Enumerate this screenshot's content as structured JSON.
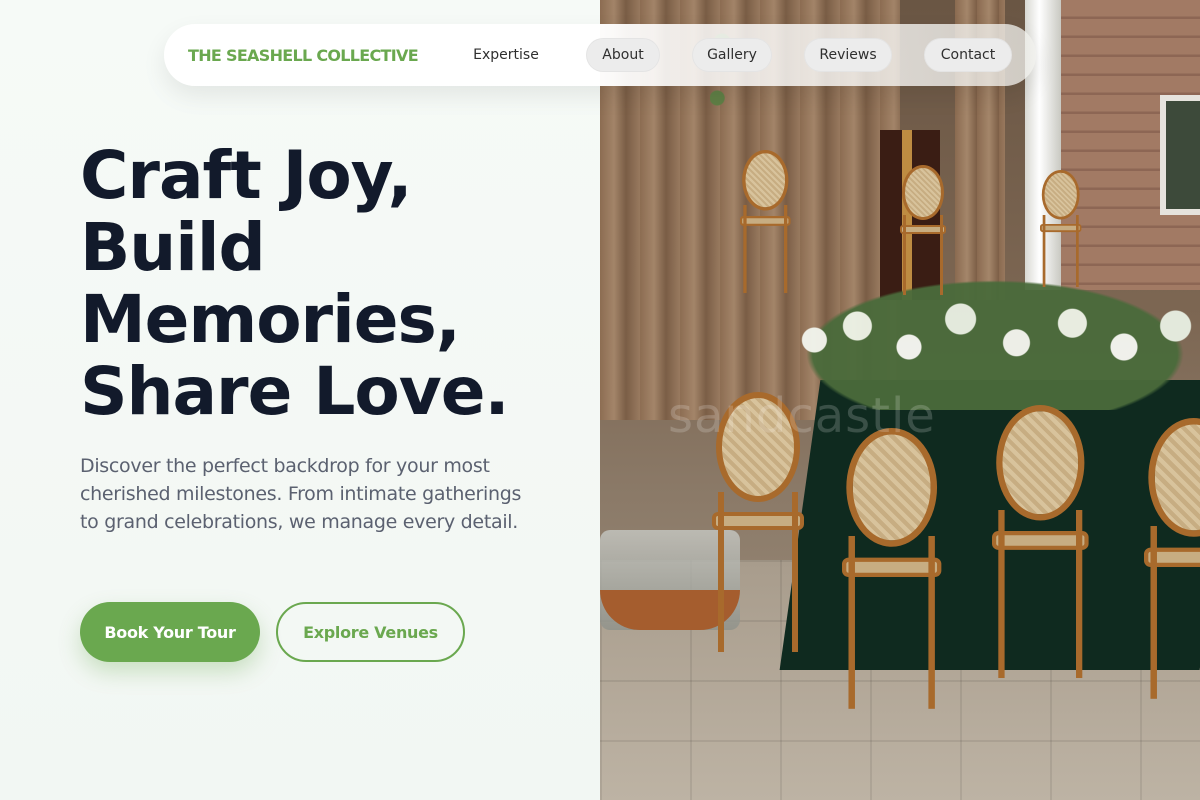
{
  "brand": {
    "name": "THE SEASHELL COLLECTIVE"
  },
  "nav": {
    "items": [
      {
        "label": "Expertise",
        "active": false
      },
      {
        "label": "About",
        "active": true
      },
      {
        "label": "Gallery",
        "active": true
      },
      {
        "label": "Reviews",
        "active": true
      },
      {
        "label": "Contact",
        "active": true
      }
    ]
  },
  "hero": {
    "headline_lines": [
      "Craft Joy,",
      "Build",
      "Memories,",
      "Share Love."
    ],
    "subtext": "Discover the perfect backdrop for your most cherished milestones. From intimate gatherings to grand celebrations, we manage every detail.",
    "primary_cta": "Book Your Tour",
    "secondary_cta": "Explore Venues"
  },
  "image": {
    "watermark": "sandcastle"
  },
  "colors": {
    "accent": "#6aa84f",
    "headline": "#121a2b",
    "body_text": "#5b6170",
    "background": "#f3f8f4"
  }
}
